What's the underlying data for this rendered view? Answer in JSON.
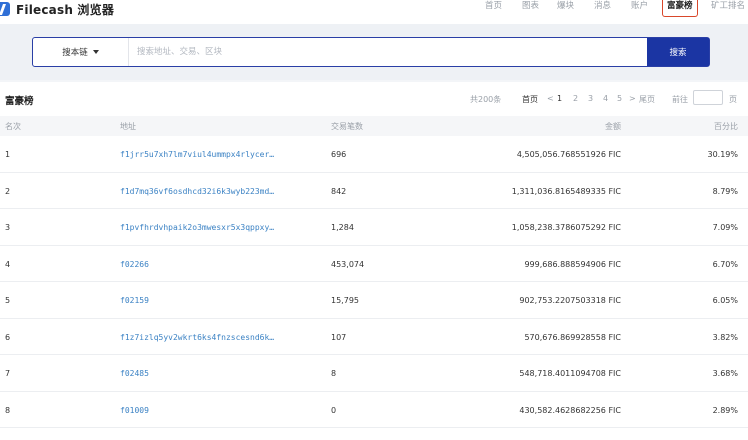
{
  "app": {
    "title": "Filecash 浏览器"
  },
  "nav": [
    "首页",
    "图表",
    "爆块",
    "消息",
    "账户",
    "富豪榜",
    "矿工排名"
  ],
  "search": {
    "select_label": "搜本链",
    "placeholder": "搜索地址、交易、区块",
    "button": "搜索"
  },
  "rich_list": {
    "title": "富豪榜",
    "total": "共200条",
    "pagination": {
      "first": "首页",
      "prev": "<",
      "pages": [
        "1",
        "2",
        "3",
        "4",
        "5"
      ],
      "next": ">",
      "last": "尾页",
      "goto": "前往",
      "page_unit": "页"
    },
    "columns": [
      "名次",
      "地址",
      "交易笔数",
      "金额",
      "百分比"
    ],
    "rows": [
      {
        "rank": "1",
        "address": "f1jrr5u7xh7lm7viul4ummpx4rlycer…",
        "tx": "696",
        "amount": "4,505,056.768551926 FIC",
        "pct": "30.19%"
      },
      {
        "rank": "2",
        "address": "f1d7mq36vf6osdhcd32i6k3wyb223md…",
        "tx": "842",
        "amount": "1,311,036.8165489335 FIC",
        "pct": "8.79%"
      },
      {
        "rank": "3",
        "address": "f1pvfhrdvhpaik2o3mwesxr5x3qppxy…",
        "tx": "1,284",
        "amount": "1,058,238.3786075292 FIC",
        "pct": "7.09%"
      },
      {
        "rank": "4",
        "address": "f02266",
        "tx": "453,074",
        "amount": "999,686.888594906 FIC",
        "pct": "6.70%"
      },
      {
        "rank": "5",
        "address": "f02159",
        "tx": "15,795",
        "amount": "902,753.2207503318 FIC",
        "pct": "6.05%"
      },
      {
        "rank": "6",
        "address": "f1z7izlq5yv2wkrt6ks4fnzscesnd6k…",
        "tx": "107",
        "amount": "570,676.869928558 FIC",
        "pct": "3.82%"
      },
      {
        "rank": "7",
        "address": "f02485",
        "tx": "8",
        "amount": "548,718.4011094708 FIC",
        "pct": "3.68%"
      },
      {
        "rank": "8",
        "address": "f01009",
        "tx": "0",
        "amount": "430,582.4628682256 FIC",
        "pct": "2.89%"
      }
    ]
  },
  "colors": {
    "brand": "#1b35a3",
    "link": "#3b82c4",
    "active_nav_border": "#d9472b"
  }
}
